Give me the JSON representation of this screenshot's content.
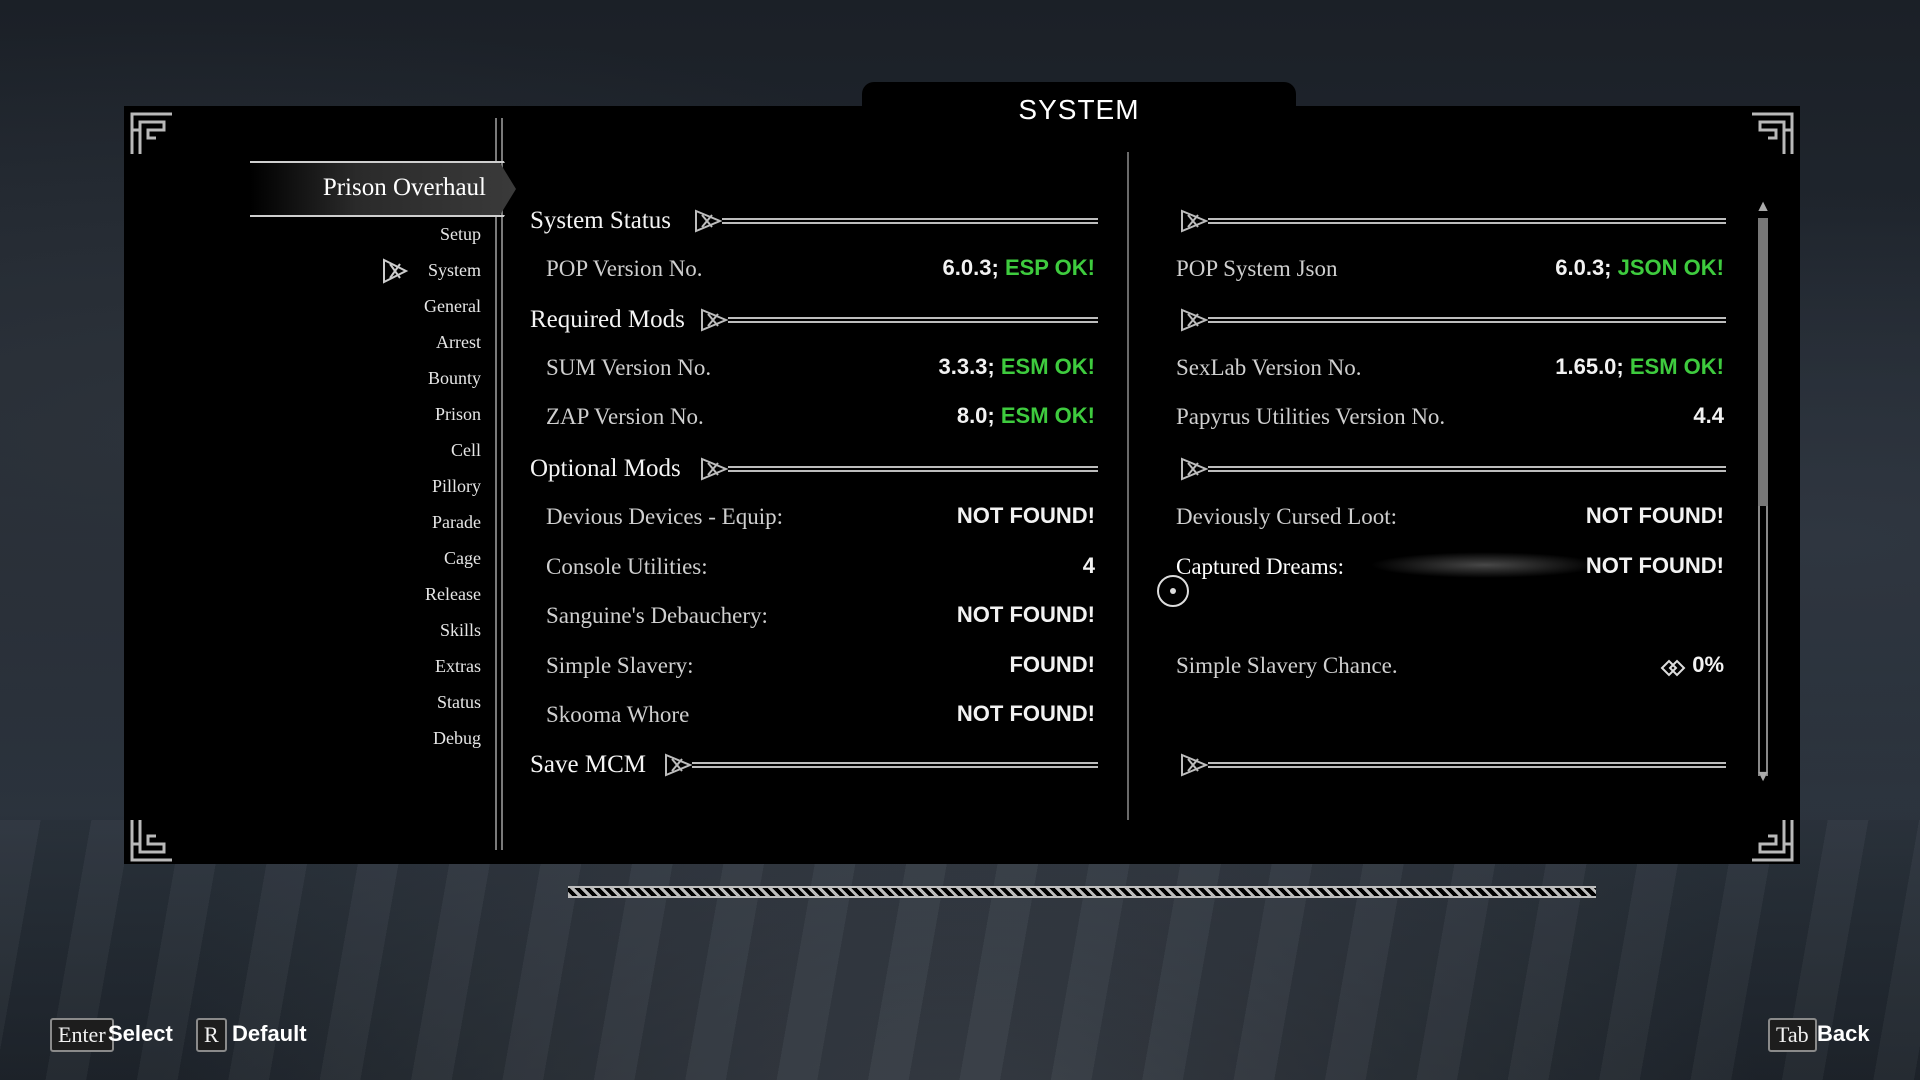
{
  "title": "SYSTEM",
  "sidebar": {
    "active_page": "Prison Overhaul",
    "items": [
      "Setup",
      "System",
      "General",
      "Arrest",
      "Bounty",
      "Prison",
      "Cell",
      "Pillory",
      "Parade",
      "Cage",
      "Release",
      "Skills",
      "Extras",
      "Status",
      "Debug"
    ],
    "selected_item": "System"
  },
  "sections": {
    "system_status": {
      "header": "System Status",
      "left": [
        {
          "label": "POP Version No.",
          "value": "6.0.3;",
          "status": "ESP OK!"
        }
      ],
      "right": [
        {
          "label": "POP System Json",
          "value": "6.0.3;",
          "status": "JSON OK!"
        }
      ]
    },
    "required_mods": {
      "header": "Required Mods",
      "left": [
        {
          "label": "SUM Version No.",
          "value": "3.3.3;",
          "status": "ESM OK!"
        },
        {
          "label": "ZAP Version No.",
          "value": "8.0;",
          "status": "ESM OK!"
        }
      ],
      "right": [
        {
          "label": "SexLab Version No.",
          "value": "1.65.0;",
          "status": "ESM OK!"
        },
        {
          "label": "Papyrus Utilities Version No.",
          "value": "4.4"
        }
      ]
    },
    "optional_mods": {
      "header": "Optional Mods",
      "left": [
        {
          "label": "Devious Devices - Equip:",
          "value": "NOT FOUND!"
        },
        {
          "label": "Console Utilities:",
          "value": "4"
        },
        {
          "label": "Sanguine's Debauchery:",
          "value": "NOT FOUND!"
        },
        {
          "label": "Simple Slavery:",
          "value": "FOUND!"
        },
        {
          "label": "Skooma Whore",
          "value": "NOT FOUND!"
        }
      ],
      "right": [
        {
          "label": "Deviously Cursed Loot:",
          "value": "NOT FOUND!"
        },
        {
          "label": "Captured Dreams:",
          "value": "NOT FOUND!"
        },
        {
          "label": "Simple Slavery Chance.",
          "value": "0%"
        }
      ]
    },
    "save_mcm": {
      "header": "Save MCM"
    }
  },
  "footer": {
    "enter_key": "Enter",
    "enter_label": "Select",
    "r_key": "R",
    "r_label": "Default",
    "tab_key": "Tab",
    "tab_label": "Back"
  },
  "colors": {
    "ok": "#3ecb3e",
    "panel": "#000000",
    "text": "#e8e8e8"
  },
  "icons": [
    "corner-ornament-icon",
    "knot-icon",
    "selected-knot-icon",
    "scroll-up-icon",
    "scroll-down-icon",
    "cursor-icon",
    "slider-arrows-icon"
  ]
}
